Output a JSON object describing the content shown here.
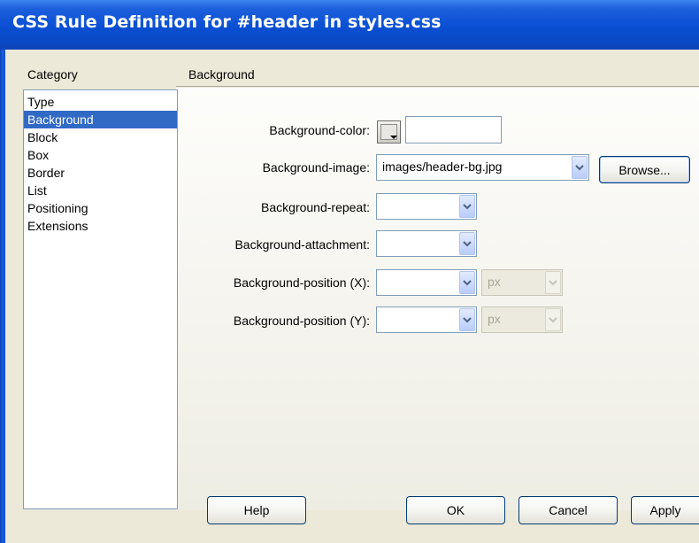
{
  "window": {
    "title": "CSS Rule Definition for #header in styles.css"
  },
  "category": {
    "header": "Category",
    "items": [
      "Type",
      "Background",
      "Block",
      "Box",
      "Border",
      "List",
      "Positioning",
      "Extensions"
    ],
    "selected": "Background"
  },
  "section": {
    "header": "Background"
  },
  "fields": {
    "bg_color": {
      "label": "Background-color:",
      "value": ""
    },
    "bg_image": {
      "label": "Background-image:",
      "value": "images/header-bg.jpg"
    },
    "browse_label": "Browse...",
    "bg_repeat": {
      "label": "Background-repeat:",
      "value": ""
    },
    "bg_attachment": {
      "label": "Background-attachment:",
      "value": ""
    },
    "bg_pos_x": {
      "label": "Background-position (X):",
      "value": "",
      "unit": "px"
    },
    "bg_pos_y": {
      "label": "Background-position (Y):",
      "value": "",
      "unit": "px"
    }
  },
  "buttons": {
    "help": "Help",
    "ok": "OK",
    "cancel": "Cancel",
    "apply": "Apply"
  },
  "colors": {
    "title_bar": "#0a4fd3",
    "selection": "#316ac5",
    "dialog_bg": "#ece9d8"
  },
  "icons": {
    "dropdown": "chevron-down-icon",
    "color_picker": "color-swatch-icon"
  }
}
